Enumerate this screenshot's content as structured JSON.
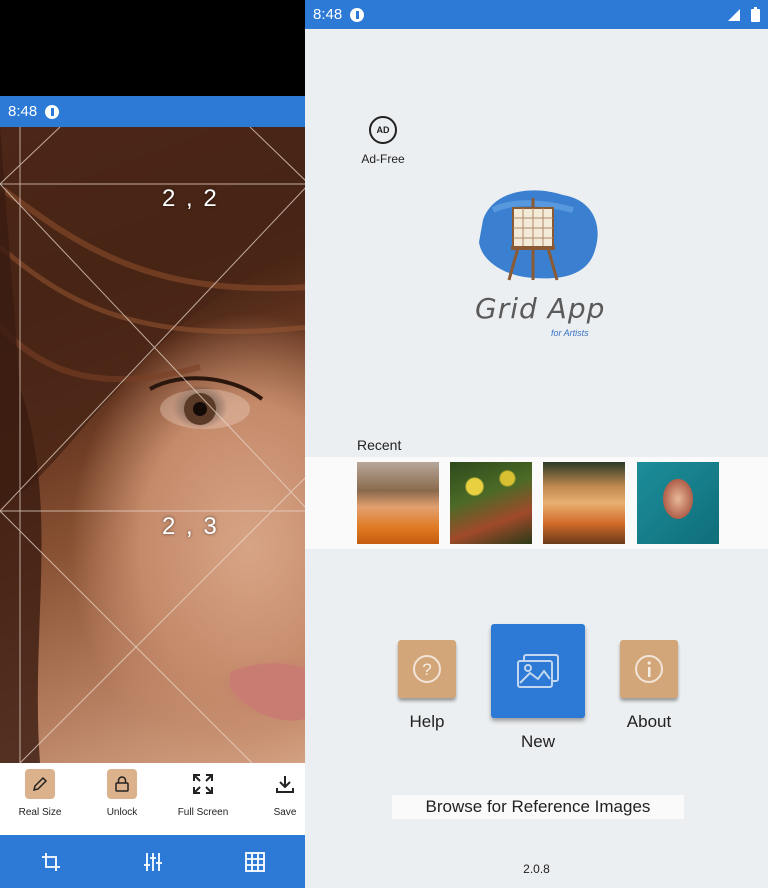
{
  "left_phone": {
    "status_time": "8:48",
    "grid_cells": [
      "2 , 2",
      "2 , 3"
    ],
    "toolbar": [
      {
        "label": "Real Size",
        "icon": "ruler-pencil-icon"
      },
      {
        "label": "Unlock",
        "icon": "lock-icon"
      },
      {
        "label": "Full Screen",
        "icon": "fullscreen-icon"
      },
      {
        "label": "Save",
        "icon": "download-icon"
      }
    ],
    "bottom_nav": [
      "crop-icon",
      "sliders-icon",
      "grid-icon"
    ]
  },
  "right_phone": {
    "status_time": "8:48",
    "ad_free_label": "Ad-Free",
    "ad_icon_text": "AD",
    "logo": {
      "title": "Grid App",
      "subtitle": "for Artists"
    },
    "recent_label": "Recent",
    "recent_thumbnails": 4,
    "tiles": {
      "help": "Help",
      "new": "New",
      "about": "About"
    },
    "browse_label": "Browse for Reference Images",
    "version": "2.0.8"
  },
  "colors": {
    "accent": "#2c7ad6",
    "tile_tan": "#d2a679",
    "background": "#eceff1"
  }
}
